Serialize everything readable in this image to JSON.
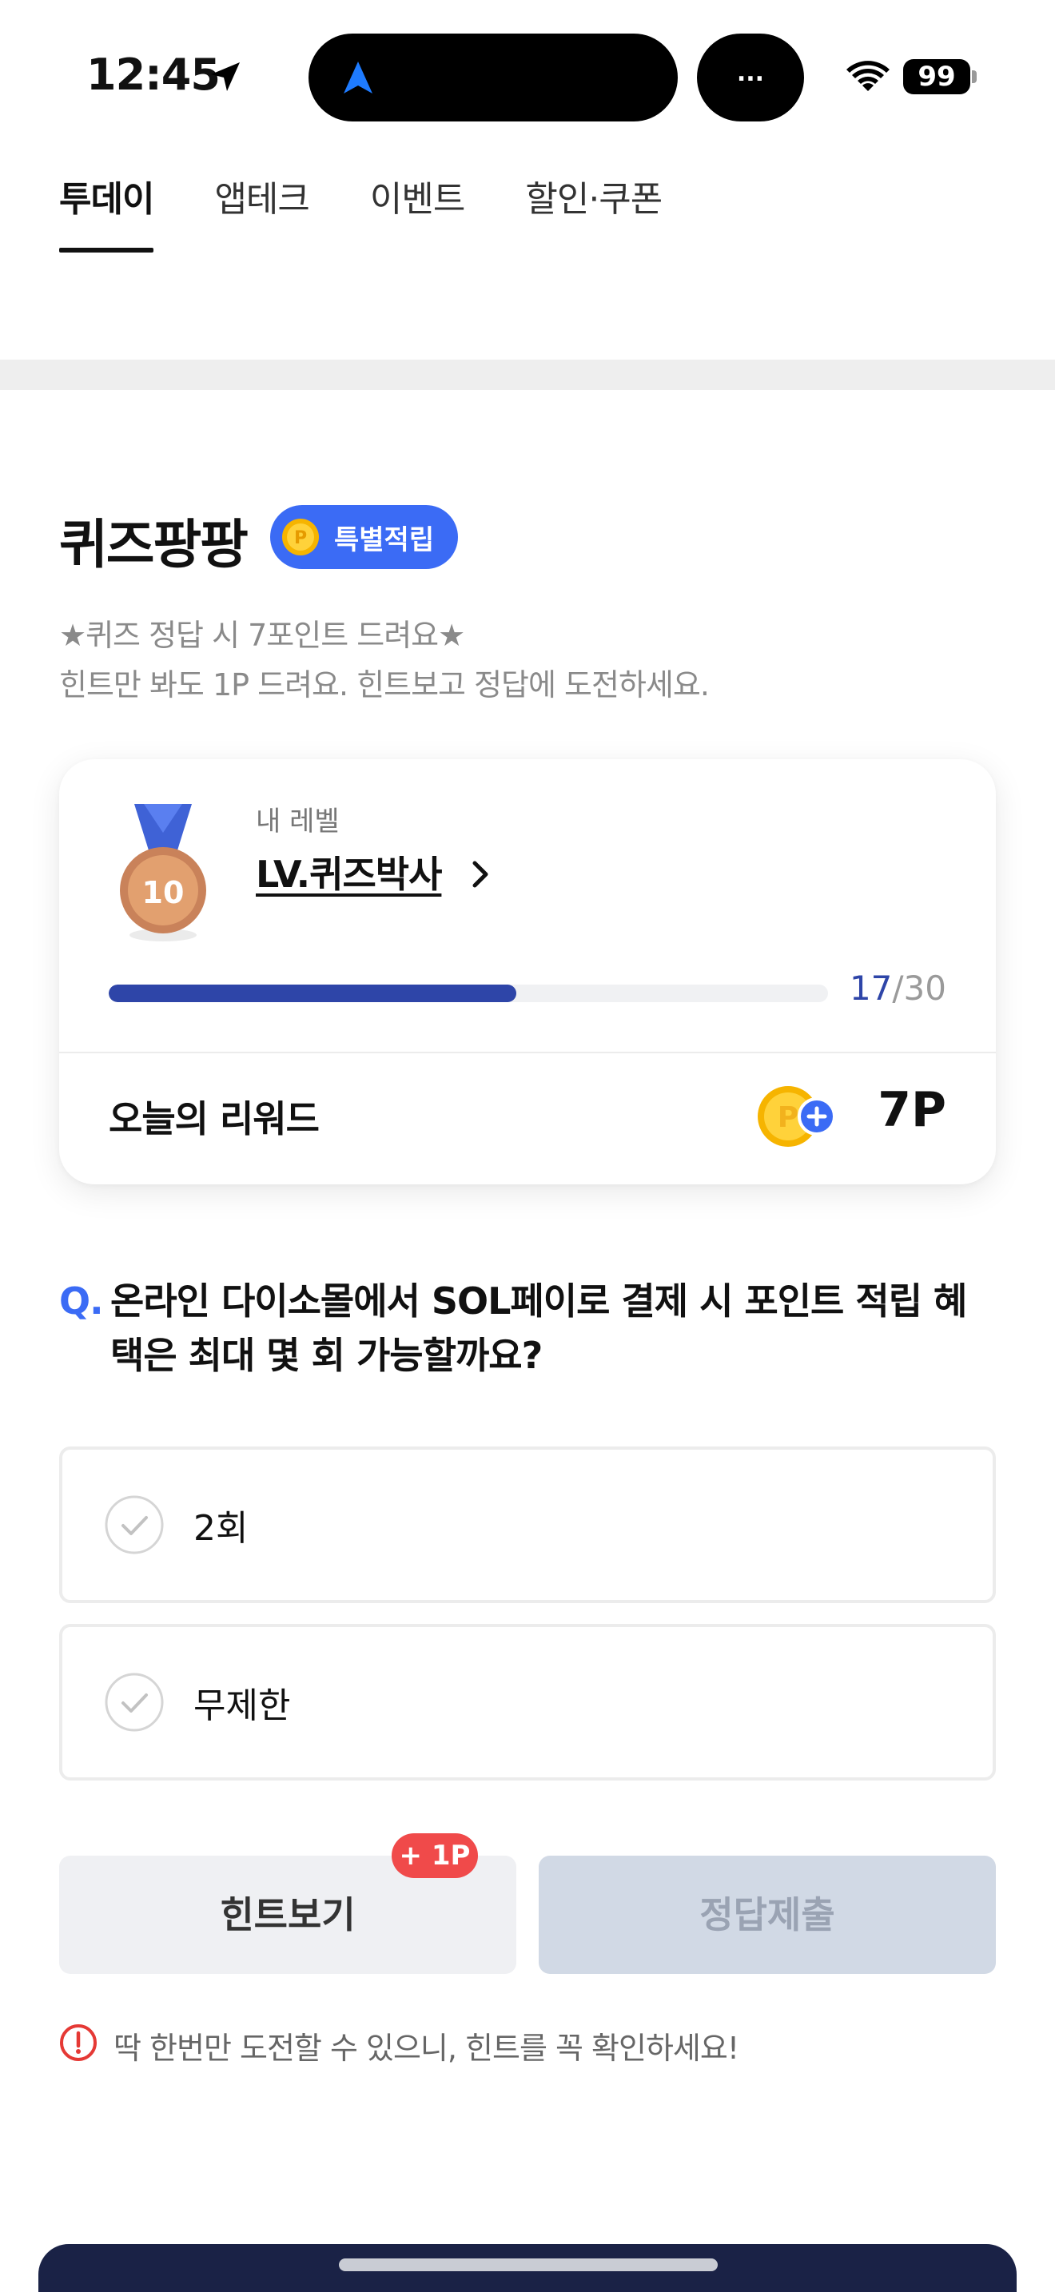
{
  "status_bar": {
    "time": "12:45",
    "island_pill": "...",
    "battery": "99"
  },
  "tabs": [
    {
      "label": "투데이",
      "active": true
    },
    {
      "label": "앱테크",
      "active": false
    },
    {
      "label": "이벤트",
      "active": false
    },
    {
      "label": "할인·쿠폰",
      "active": false
    }
  ],
  "quiz": {
    "title": "퀴즈팡팡",
    "badge": "특별적립",
    "desc_line1": "★퀴즈 정답 시 7포인트 드려요★",
    "desc_line2": "힌트만 봐도 1P 드려요. 힌트보고 정답에 도전하세요."
  },
  "level_card": {
    "caption": "내 레벨",
    "level_name": "LV.퀴즈박사",
    "medal_number": "10",
    "progress_current": "17",
    "progress_total": "/30",
    "progress_fraction": 0.567,
    "reward_label": "오늘의 리워드",
    "reward_value": "7P"
  },
  "question": {
    "prefix": "Q.",
    "text": "온라인 다이소몰에서 SOL페이로 결제 시 포인트 적립 혜택은 최대 몇 회 가능할까요?"
  },
  "options": [
    {
      "label": "2회"
    },
    {
      "label": "무제한"
    }
  ],
  "buttons": {
    "hint": "힌트보기",
    "hint_badge": "+ 1P",
    "submit": "정답제출"
  },
  "notice": "딱 한번만 도전할 수 있으니, 힌트를 꼭 확인하세요!",
  "colors": {
    "accent": "#3b6bf5",
    "progress": "#2e45a8",
    "hint_badge": "#f04a4a",
    "submit_disabled": "#d1d9e5",
    "banner": "#1a2246"
  },
  "icons": [
    "location-arrow-icon",
    "navigation-icon",
    "wifi-icon",
    "coin-icon",
    "medal-icon",
    "chevron-right-icon",
    "coin-plus-icon",
    "check-circle-icon",
    "alert-icon"
  ]
}
